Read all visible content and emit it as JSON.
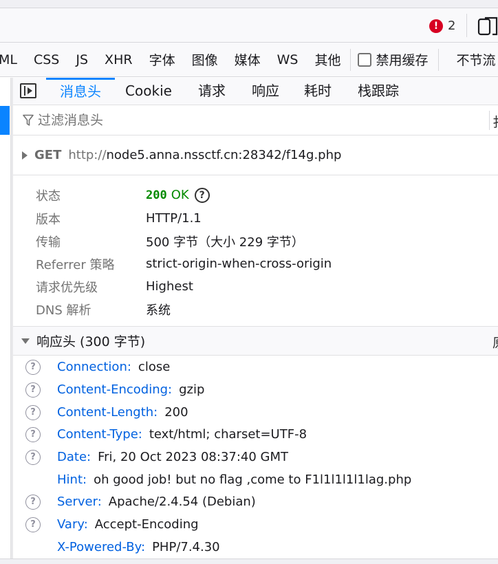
{
  "toolbar_top": {
    "error_count": "2"
  },
  "filter_types": [
    "ML",
    "CSS",
    "JS",
    "XHR",
    "字体",
    "图像",
    "媒体",
    "WS",
    "其他"
  ],
  "disable_cache_label": "禁用缓存",
  "throttle_label": "不节流",
  "tabs": [
    "消息头",
    "Cookie",
    "请求",
    "响应",
    "耗时",
    "栈跟踪"
  ],
  "active_tab": "消息头",
  "filter": {
    "placeholder": "过滤消息头",
    "right_glyph": "扌"
  },
  "request": {
    "method": "GET",
    "scheme": "http://",
    "url_rest": "node5.anna.nssctf.cn:28342/f14g.php"
  },
  "info": {
    "status_key": "状态",
    "status_code": "200",
    "status_text": "OK",
    "version_key": "版本",
    "version_val": "HTTP/1.1",
    "transfer_key": "传输",
    "transfer_val": "500 字节（大小 229 字节）",
    "referrer_key": "Referrer 策略",
    "referrer_val": "strict-origin-when-cross-origin",
    "priority_key": "请求优先级",
    "priority_val": "Highest",
    "dns_key": "DNS 解析",
    "dns_val": "系统"
  },
  "response_section": {
    "title": "响应头 (300 字节)",
    "right_glyph": "原"
  },
  "response_headers": [
    {
      "name": "Connection:",
      "value": "close",
      "help": true
    },
    {
      "name": "Content-Encoding:",
      "value": "gzip",
      "help": true
    },
    {
      "name": "Content-Length:",
      "value": "200",
      "help": true
    },
    {
      "name": "Content-Type:",
      "value": "text/html; charset=UTF-8",
      "help": true
    },
    {
      "name": "Date:",
      "value": "Fri, 20 Oct 2023 08:37:40 GMT",
      "help": true
    },
    {
      "name": "Hint:",
      "value": "oh good job! but no flag ,come to F1l1l1l1l1lag.php",
      "help": false
    },
    {
      "name": "Server:",
      "value": "Apache/2.4.54 (Debian)",
      "help": true
    },
    {
      "name": "Vary:",
      "value": "Accept-Encoding",
      "help": true
    },
    {
      "name": "X-Powered-By:",
      "value": "PHP/7.4.30",
      "help": false
    }
  ],
  "colors": {
    "accent": "#0a84ff",
    "header_name": "#0061e0",
    "status_ok": "#058b00",
    "error_badge": "#d70022"
  }
}
